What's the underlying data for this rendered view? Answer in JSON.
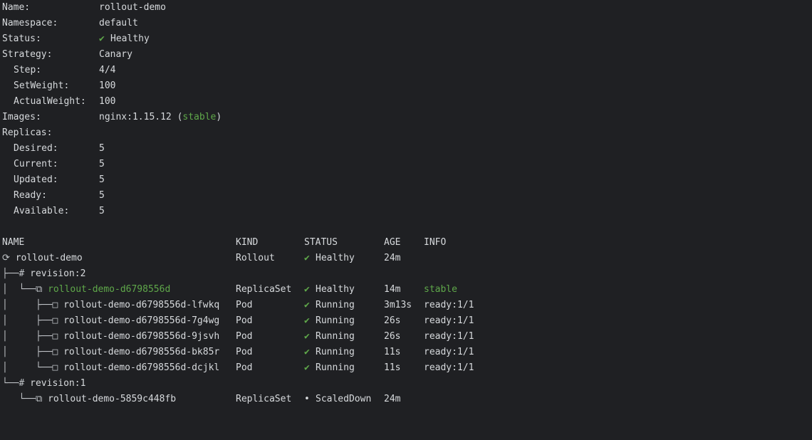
{
  "summary": {
    "name_label": "Name:",
    "name_value": "rollout-demo",
    "namespace_label": "Namespace:",
    "namespace_value": "default",
    "status_label": "Status:",
    "status_icon": "✔",
    "status_value": "Healthy",
    "strategy_label": "Strategy:",
    "strategy_value": "Canary",
    "step_label": "Step:",
    "step_value": "4/4",
    "setweight_label": "SetWeight:",
    "setweight_value": "100",
    "actualweight_label": "ActualWeight:",
    "actualweight_value": "100",
    "images_label": "Images:",
    "images_value": "nginx:1.15.12",
    "images_tag_open": "(",
    "images_tag": "stable",
    "images_tag_close": ")",
    "replicas_label": "Replicas:",
    "desired_label": "Desired:",
    "desired_value": "5",
    "current_label": "Current:",
    "current_value": "5",
    "updated_label": "Updated:",
    "updated_value": "5",
    "ready_label": "Ready:",
    "ready_value": "5",
    "available_label": "Available:",
    "available_value": "5"
  },
  "table": {
    "headers": {
      "name": "NAME",
      "kind": "KIND",
      "status": "STATUS",
      "age": "AGE",
      "info": "INFO"
    },
    "rows": [
      {
        "prefix": "⟳ ",
        "name": "rollout-demo",
        "kind": "Rollout",
        "status_icon": "✔",
        "status": "Healthy",
        "age": "24m",
        "info": ""
      },
      {
        "prefix": "├──# ",
        "name": "revision:2",
        "kind": "",
        "status_icon": "",
        "status": "",
        "age": "",
        "info": ""
      },
      {
        "prefix": "│  └──⧉ ",
        "name": "rollout-demo-d6798556d",
        "kind": "ReplicaSet",
        "status_icon": "✔",
        "status": "Healthy",
        "age": "14m",
        "info": "stable"
      },
      {
        "prefix": "│     ├──□ ",
        "name": "rollout-demo-d6798556d-lfwkq",
        "kind": "Pod",
        "status_icon": "✔",
        "status": "Running",
        "age": "3m13s",
        "info": "ready:1/1"
      },
      {
        "prefix": "│     ├──□ ",
        "name": "rollout-demo-d6798556d-7g4wg",
        "kind": "Pod",
        "status_icon": "✔",
        "status": "Running",
        "age": "26s",
        "info": "ready:1/1"
      },
      {
        "prefix": "│     ├──□ ",
        "name": "rollout-demo-d6798556d-9jsvh",
        "kind": "Pod",
        "status_icon": "✔",
        "status": "Running",
        "age": "26s",
        "info": "ready:1/1"
      },
      {
        "prefix": "│     ├──□ ",
        "name": "rollout-demo-d6798556d-bk85r",
        "kind": "Pod",
        "status_icon": "✔",
        "status": "Running",
        "age": "11s",
        "info": "ready:1/1"
      },
      {
        "prefix": "│     └──□ ",
        "name": "rollout-demo-d6798556d-dcjkl",
        "kind": "Pod",
        "status_icon": "✔",
        "status": "Running",
        "age": "11s",
        "info": "ready:1/1"
      },
      {
        "prefix": "└──# ",
        "name": "revision:1",
        "kind": "",
        "status_icon": "",
        "status": "",
        "age": "",
        "info": ""
      },
      {
        "prefix": "   └──⧉ ",
        "name": "rollout-demo-5859c448fb",
        "kind": "ReplicaSet",
        "status_icon": "•",
        "status": "ScaledDown",
        "age": "24m",
        "info": ""
      }
    ]
  },
  "colors": {
    "background": "#1f2023",
    "text": "#d7dadd",
    "healthy": "#5fa84a",
    "stable": "#5fa84a"
  }
}
